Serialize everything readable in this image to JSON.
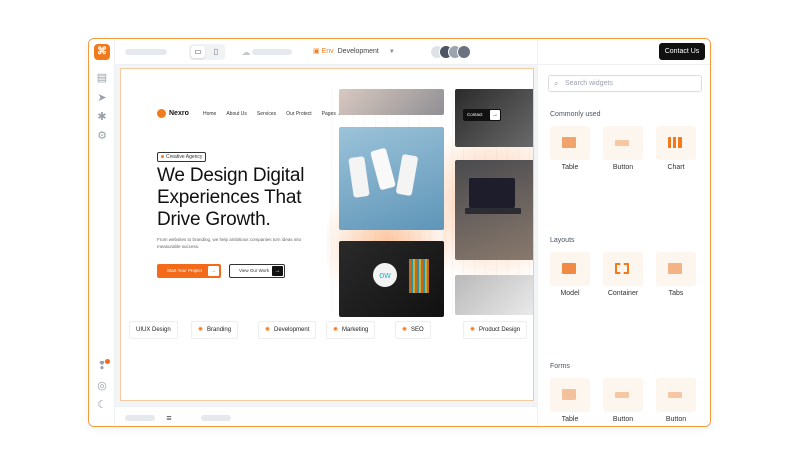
{
  "topbar": {
    "environment_label": "Env",
    "environment_value": "Development"
  },
  "panel": {
    "contact_button": "Contact Us",
    "search_placeholder": "Search widgets",
    "sections": [
      {
        "title": "Commonly used",
        "items": [
          {
            "label": "Table",
            "icon": "table-icon",
            "color": "#f0a36b"
          },
          {
            "label": "Button",
            "icon": "button-icon",
            "color": "#f6c7a3"
          },
          {
            "label": "Chart",
            "icon": "chart-icon",
            "color": "#f27a1a"
          }
        ]
      },
      {
        "title": "Layouts",
        "items": [
          {
            "label": "Model",
            "icon": "modal-icon",
            "color": "#f08a44"
          },
          {
            "label": "Container",
            "icon": "container-icon",
            "color": "#f27a1a"
          },
          {
            "label": "Tabs",
            "icon": "tabs-icon",
            "color": "#f3b384"
          }
        ]
      },
      {
        "title": "Forms",
        "items": [
          {
            "label": "Table",
            "icon": "table-icon",
            "color": "#f3c19c"
          },
          {
            "label": "Button",
            "icon": "button-icon",
            "color": "#f6c7a3"
          },
          {
            "label": "Button",
            "icon": "button-icon",
            "color": "#f6c7a3"
          }
        ]
      }
    ]
  },
  "site": {
    "brand": "Nexro",
    "nav": [
      "Home",
      "About Us",
      "Services",
      "Our Protect",
      "Pages"
    ],
    "contact": "Contact",
    "badge": "Creative Agency",
    "headline": "We Design Digital Experiences That Drive Growth.",
    "subtext": "From websites to branding, we help ambitious companies turn ideas into measurable success.",
    "cta_primary": "Start Your Project",
    "cta_secondary": "View Our Work",
    "ticker": [
      "UIUX Design",
      "Branding",
      "Development",
      "Marketing",
      "SEO",
      "Product Design"
    ]
  },
  "colors": {
    "accent": "#f27a1a",
    "border": "#f59a3c"
  }
}
